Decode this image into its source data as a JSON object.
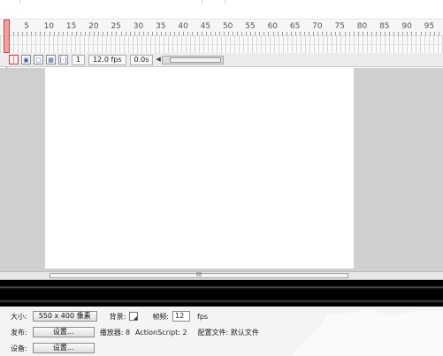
{
  "timeline": {
    "ruler_labels": [
      "5",
      "10",
      "15",
      "20",
      "25",
      "30",
      "35",
      "40",
      "45",
      "50",
      "55",
      "60",
      "65",
      "70",
      "75",
      "80",
      "85",
      "90",
      "95"
    ]
  },
  "toolbar": {
    "current_frame": "1",
    "frame_rate": "12.0 fps",
    "elapsed_time": "0.0s"
  },
  "stage": {
    "scroll_grip": "III"
  },
  "properties": {
    "size_label": "大小:",
    "size_button": "550 x 400 像素",
    "background_label": "背景:",
    "frame_rate_label": "帧频:",
    "frame_rate_value": "12",
    "fps_unit": "fps",
    "publish_label": "发布:",
    "publish_settings_button": "设置...",
    "player_label": "播放器: 8",
    "actionscript_label": "ActionScript: 2",
    "profile_label": "配置文件: 默认文件",
    "settings_label": "设备:",
    "settings_button": "设置..."
  },
  "colors": {
    "playhead": "#d04040",
    "stage_background": "#ffffff",
    "work_area": "#cfcfcf"
  }
}
